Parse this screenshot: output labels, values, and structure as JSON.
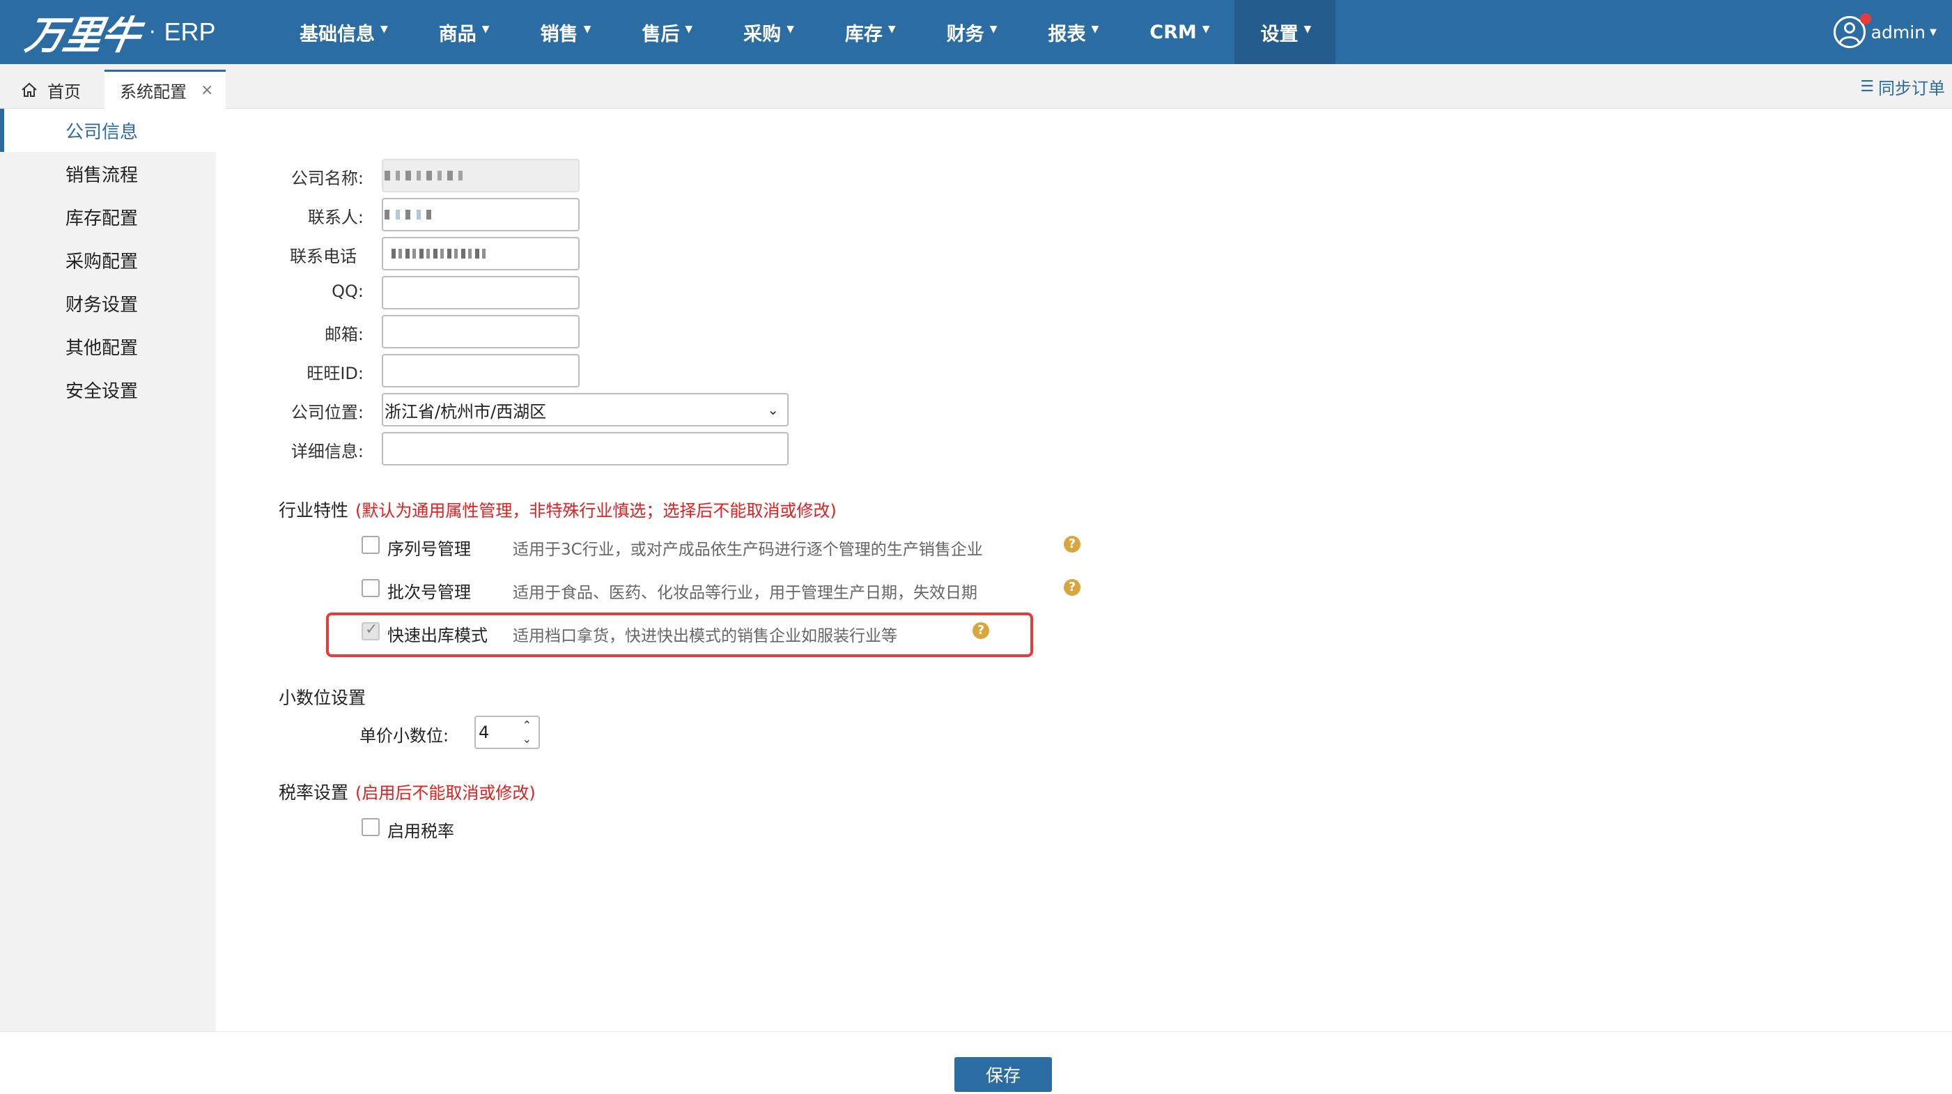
{
  "app": {
    "logo_text": "万里牛",
    "logo_dot": "·",
    "logo_suffix": "ERP"
  },
  "nav": [
    {
      "label": "基础信息"
    },
    {
      "label": "商品"
    },
    {
      "label": "销售"
    },
    {
      "label": "售后"
    },
    {
      "label": "采购"
    },
    {
      "label": "库存"
    },
    {
      "label": "财务"
    },
    {
      "label": "报表"
    },
    {
      "label": "CRM"
    },
    {
      "label": "设置",
      "active": true
    }
  ],
  "user": {
    "name": "admin",
    "has_notification": true
  },
  "tabs": [
    {
      "label": "首页",
      "icon": "home-icon"
    },
    {
      "label": "系统配置",
      "active": true,
      "closable": true,
      "close_glyph": "×"
    }
  ],
  "sync": {
    "label": "同步订单",
    "icon": "list-icon"
  },
  "sidebar": {
    "items": [
      {
        "label": "公司信息",
        "active": true
      },
      {
        "label": "销售流程"
      },
      {
        "label": "库存配置"
      },
      {
        "label": "采购配置"
      },
      {
        "label": "财务设置"
      },
      {
        "label": "其他配置"
      },
      {
        "label": "安全设置"
      }
    ]
  },
  "form": {
    "company_name_label": "公司名称:",
    "contact_label": "联系人:",
    "phone_label": "联系电话",
    "qq_label": "QQ:",
    "email_label": "邮箱:",
    "wangwang_label": "旺旺ID:",
    "location_label": "公司位置:",
    "location_value": "浙江省/杭州市/西湖区",
    "detail_label": "详细信息:"
  },
  "industry": {
    "title": "行业特性",
    "note": "(默认为通用属性管理，非特殊行业慎选；选择后不能取消或修改)",
    "options": [
      {
        "label": "序列号管理",
        "desc": "适用于3C行业，或对产成品依生产码进行逐个管理的生产销售企业",
        "checked": false
      },
      {
        "label": "批次号管理",
        "desc": "适用于食品、医药、化妆品等行业，用于管理生产日期，失效日期",
        "checked": false
      },
      {
        "label": "快速出库模式",
        "desc": "适用档口拿货，快进快出模式的销售企业如服装行业等",
        "checked": true
      }
    ],
    "help_glyph": "?"
  },
  "decimal": {
    "title": "小数位设置",
    "price_label": "单价小数位:",
    "price_value": "4"
  },
  "tax": {
    "title": "税率设置",
    "note": "(启用后不能取消或修改)",
    "enable_label": "启用税率",
    "checked": false
  },
  "footer": {
    "save_label": "保存"
  },
  "colors": {
    "primary": "#2b6ca3",
    "warning": "#e02020",
    "help": "#d8a63a"
  }
}
